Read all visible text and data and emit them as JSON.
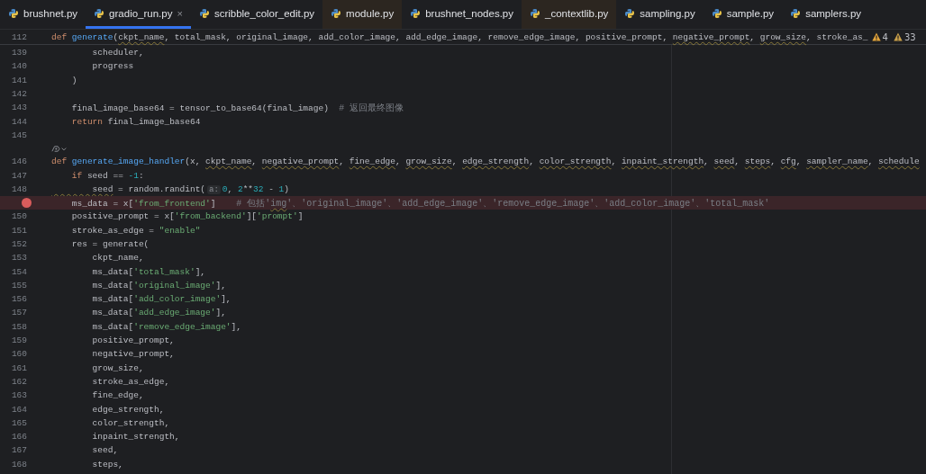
{
  "tabs": [
    {
      "label": "brushnet.py",
      "selected": false,
      "external": false,
      "closable": false
    },
    {
      "label": "gradio_run.py",
      "selected": true,
      "external": false,
      "closable": true,
      "close": "×"
    },
    {
      "label": "scribble_color_edit.py",
      "selected": false,
      "external": false,
      "closable": false
    },
    {
      "label": "module.py",
      "selected": false,
      "external": true,
      "closable": false
    },
    {
      "label": "brushnet_nodes.py",
      "selected": false,
      "external": false,
      "closable": false
    },
    {
      "label": "_contextlib.py",
      "selected": false,
      "external": true,
      "closable": false
    },
    {
      "label": "sampling.py",
      "selected": false,
      "external": false,
      "closable": false
    },
    {
      "label": "sample.py",
      "selected": false,
      "external": false,
      "closable": false
    },
    {
      "label": "samplers.py",
      "selected": false,
      "external": false,
      "closable": false
    }
  ],
  "sticky_header": {
    "number": "112",
    "segments": [
      {
        "text": "def ",
        "kind": "keyword"
      },
      {
        "text": "generate",
        "kind": "function"
      },
      {
        "text": "(",
        "kind": "plain"
      },
      {
        "text": "ckpt_name",
        "kind": "warned"
      },
      {
        "text": ", total_mask, original_image, add_color_image, add_edge_image, remove_edge_image, positive_prompt, ",
        "kind": "plain"
      },
      {
        "text": "negative_prompt",
        "kind": "warned"
      },
      {
        "text": ", ",
        "kind": "plain"
      },
      {
        "text": "grow_size",
        "kind": "warned"
      },
      {
        "text": ", stroke_as_",
        "kind": "plain"
      }
    ]
  },
  "inspections": [
    {
      "kind": "warning",
      "count": "4"
    },
    {
      "kind": "weak_warning",
      "count": "33"
    }
  ],
  "lines": [
    {
      "kind": "code",
      "number": "139",
      "breakpoint": false,
      "segments": [
        {
          "text": "        scheduler,",
          "kind": "plain"
        }
      ]
    },
    {
      "kind": "code",
      "number": "140",
      "breakpoint": false,
      "segments": [
        {
          "text": "        progress",
          "kind": "plain"
        }
      ]
    },
    {
      "kind": "code",
      "number": "141",
      "breakpoint": false,
      "segments": [
        {
          "text": "    )",
          "kind": "plain"
        }
      ]
    },
    {
      "kind": "code",
      "number": "142",
      "breakpoint": false
    },
    {
      "kind": "code",
      "number": "143",
      "breakpoint": false,
      "segments": [
        {
          "text": "    final_image_base64 = tensor_to_base64(final_image)  ",
          "kind": "plain"
        },
        {
          "text": "# 返回最终图像",
          "kind": "comment"
        }
      ]
    },
    {
      "kind": "code",
      "number": "144",
      "breakpoint": false,
      "segments": [
        {
          "text": "    return",
          "kind": "keyword"
        },
        {
          "text": " final_image_base64",
          "kind": "plain"
        }
      ]
    },
    {
      "kind": "code",
      "number": "145",
      "breakpoint": false
    },
    {
      "kind": "inlay"
    },
    {
      "kind": "code",
      "number": "146",
      "breakpoint": false,
      "segments": [
        {
          "text": "def ",
          "kind": "keyword"
        },
        {
          "text": "generate_image_handler",
          "kind": "function"
        },
        {
          "text": "(x, ",
          "kind": "plain"
        },
        {
          "text": "ckpt_name",
          "kind": "warned"
        },
        {
          "text": ", ",
          "kind": "plain"
        },
        {
          "text": "negative_prompt",
          "kind": "warned"
        },
        {
          "text": ", ",
          "kind": "plain"
        },
        {
          "text": "fine_edge",
          "kind": "warned"
        },
        {
          "text": ", ",
          "kind": "plain"
        },
        {
          "text": "grow_size",
          "kind": "warned"
        },
        {
          "text": ", ",
          "kind": "plain"
        },
        {
          "text": "edge_strength",
          "kind": "warned"
        },
        {
          "text": ", ",
          "kind": "plain"
        },
        {
          "text": "color_strength",
          "kind": "warned"
        },
        {
          "text": ", ",
          "kind": "plain"
        },
        {
          "text": "inpaint_strength",
          "kind": "warned"
        },
        {
          "text": ", ",
          "kind": "plain"
        },
        {
          "text": "seed",
          "kind": "warned"
        },
        {
          "text": ", ",
          "kind": "plain"
        },
        {
          "text": "steps",
          "kind": "warned"
        },
        {
          "text": ", ",
          "kind": "plain"
        },
        {
          "text": "cfg",
          "kind": "warned"
        },
        {
          "text": ", ",
          "kind": "plain"
        },
        {
          "text": "sampler_name",
          "kind": "warned"
        },
        {
          "text": ", ",
          "kind": "plain"
        },
        {
          "text": "schedule",
          "kind": "warned"
        }
      ]
    },
    {
      "kind": "code",
      "number": "147",
      "breakpoint": false,
      "segments": [
        {
          "text": "    if",
          "kind": "keyword"
        },
        {
          "text": " seed == ",
          "kind": "plain"
        },
        {
          "text": "-1",
          "kind": "number"
        },
        {
          "text": ":",
          "kind": "plain"
        }
      ]
    },
    {
      "kind": "code",
      "number": "148",
      "breakpoint": false,
      "segments": [
        {
          "text": "        seed",
          "kind": "warned"
        },
        {
          "text": " = random.randint(",
          "kind": "plain"
        },
        {
          "text": "a:",
          "kind": "hint"
        },
        {
          "text": "0",
          "kind": "number"
        },
        {
          "text": ", ",
          "kind": "plain"
        },
        {
          "text": "2",
          "kind": "number"
        },
        {
          "text": "**",
          "kind": "plain"
        },
        {
          "text": "32",
          "kind": "number"
        },
        {
          "text": " - ",
          "kind": "plain"
        },
        {
          "text": "1",
          "kind": "number"
        },
        {
          "text": ")",
          "kind": "plain"
        }
      ]
    },
    {
      "kind": "code",
      "breakpoint": true,
      "segments": [
        {
          "text": "    ms_data = x[",
          "kind": "plain"
        },
        {
          "text": "'from_frontend'",
          "kind": "string"
        },
        {
          "text": "]    ",
          "kind": "plain"
        },
        {
          "text": "# 包括'",
          "kind": "comment"
        },
        {
          "text": "img",
          "kind": "warned_comment"
        },
        {
          "text": "'、'original_image'、'add_edge_image'、'remove_edge_image'、'add_color_image'、'total_mask'",
          "kind": "comment"
        }
      ]
    },
    {
      "kind": "code",
      "number": "150",
      "breakpoint": false,
      "segments": [
        {
          "text": "    positive_prompt = x[",
          "kind": "plain"
        },
        {
          "text": "'from_backend'",
          "kind": "string"
        },
        {
          "text": "][",
          "kind": "plain"
        },
        {
          "text": "'prompt'",
          "kind": "string"
        },
        {
          "text": "]",
          "kind": "plain"
        }
      ]
    },
    {
      "kind": "code",
      "number": "151",
      "breakpoint": false,
      "segments": [
        {
          "text": "    stroke_as_edge = ",
          "kind": "plain"
        },
        {
          "text": "\"enable\"",
          "kind": "string"
        }
      ]
    },
    {
      "kind": "code",
      "number": "152",
      "breakpoint": false,
      "segments": [
        {
          "text": "    res = generate(",
          "kind": "plain"
        }
      ]
    },
    {
      "kind": "code",
      "number": "153",
      "breakpoint": false,
      "segments": [
        {
          "text": "        ckpt_name,",
          "kind": "plain"
        }
      ]
    },
    {
      "kind": "code",
      "number": "154",
      "breakpoint": false,
      "segments": [
        {
          "text": "        ms_data[",
          "kind": "plain"
        },
        {
          "text": "'total_mask'",
          "kind": "string"
        },
        {
          "text": "],",
          "kind": "plain"
        }
      ]
    },
    {
      "kind": "code",
      "number": "155",
      "breakpoint": false,
      "segments": [
        {
          "text": "        ms_data[",
          "kind": "plain"
        },
        {
          "text": "'original_image'",
          "kind": "string"
        },
        {
          "text": "],",
          "kind": "plain"
        }
      ]
    },
    {
      "kind": "code",
      "number": "156",
      "breakpoint": false,
      "segments": [
        {
          "text": "        ms_data[",
          "kind": "plain"
        },
        {
          "text": "'add_color_image'",
          "kind": "string"
        },
        {
          "text": "],",
          "kind": "plain"
        }
      ]
    },
    {
      "kind": "code",
      "number": "157",
      "breakpoint": false,
      "segments": [
        {
          "text": "        ms_data[",
          "kind": "plain"
        },
        {
          "text": "'add_edge_image'",
          "kind": "string"
        },
        {
          "text": "],",
          "kind": "plain"
        }
      ]
    },
    {
      "kind": "code",
      "number": "158",
      "breakpoint": false,
      "segments": [
        {
          "text": "        ms_data[",
          "kind": "plain"
        },
        {
          "text": "'remove_edge_image'",
          "kind": "string"
        },
        {
          "text": "],",
          "kind": "plain"
        }
      ]
    },
    {
      "kind": "code",
      "number": "159",
      "breakpoint": false,
      "segments": [
        {
          "text": "        positive_prompt,",
          "kind": "plain"
        }
      ]
    },
    {
      "kind": "code",
      "number": "160",
      "breakpoint": false,
      "segments": [
        {
          "text": "        negative_prompt,",
          "kind": "plain"
        }
      ]
    },
    {
      "kind": "code",
      "number": "161",
      "breakpoint": false,
      "segments": [
        {
          "text": "        grow_size,",
          "kind": "plain"
        }
      ]
    },
    {
      "kind": "code",
      "number": "162",
      "breakpoint": false,
      "segments": [
        {
          "text": "        stroke_as_edge,",
          "kind": "plain"
        }
      ]
    },
    {
      "kind": "code",
      "number": "163",
      "breakpoint": false,
      "segments": [
        {
          "text": "        fine_edge,",
          "kind": "plain"
        }
      ]
    },
    {
      "kind": "code",
      "number": "164",
      "breakpoint": false,
      "segments": [
        {
          "text": "        edge_strength,",
          "kind": "plain"
        }
      ]
    },
    {
      "kind": "code",
      "number": "165",
      "breakpoint": false,
      "segments": [
        {
          "text": "        color_strength,",
          "kind": "plain"
        }
      ]
    },
    {
      "kind": "code",
      "number": "166",
      "breakpoint": false,
      "segments": [
        {
          "text": "        inpaint_strength,",
          "kind": "plain"
        }
      ]
    },
    {
      "kind": "code",
      "number": "167",
      "breakpoint": false,
      "segments": [
        {
          "text": "        seed,",
          "kind": "plain"
        }
      ]
    },
    {
      "kind": "code",
      "number": "168",
      "breakpoint": false,
      "segments": [
        {
          "text": "        steps,",
          "kind": "plain"
        }
      ]
    }
  ]
}
